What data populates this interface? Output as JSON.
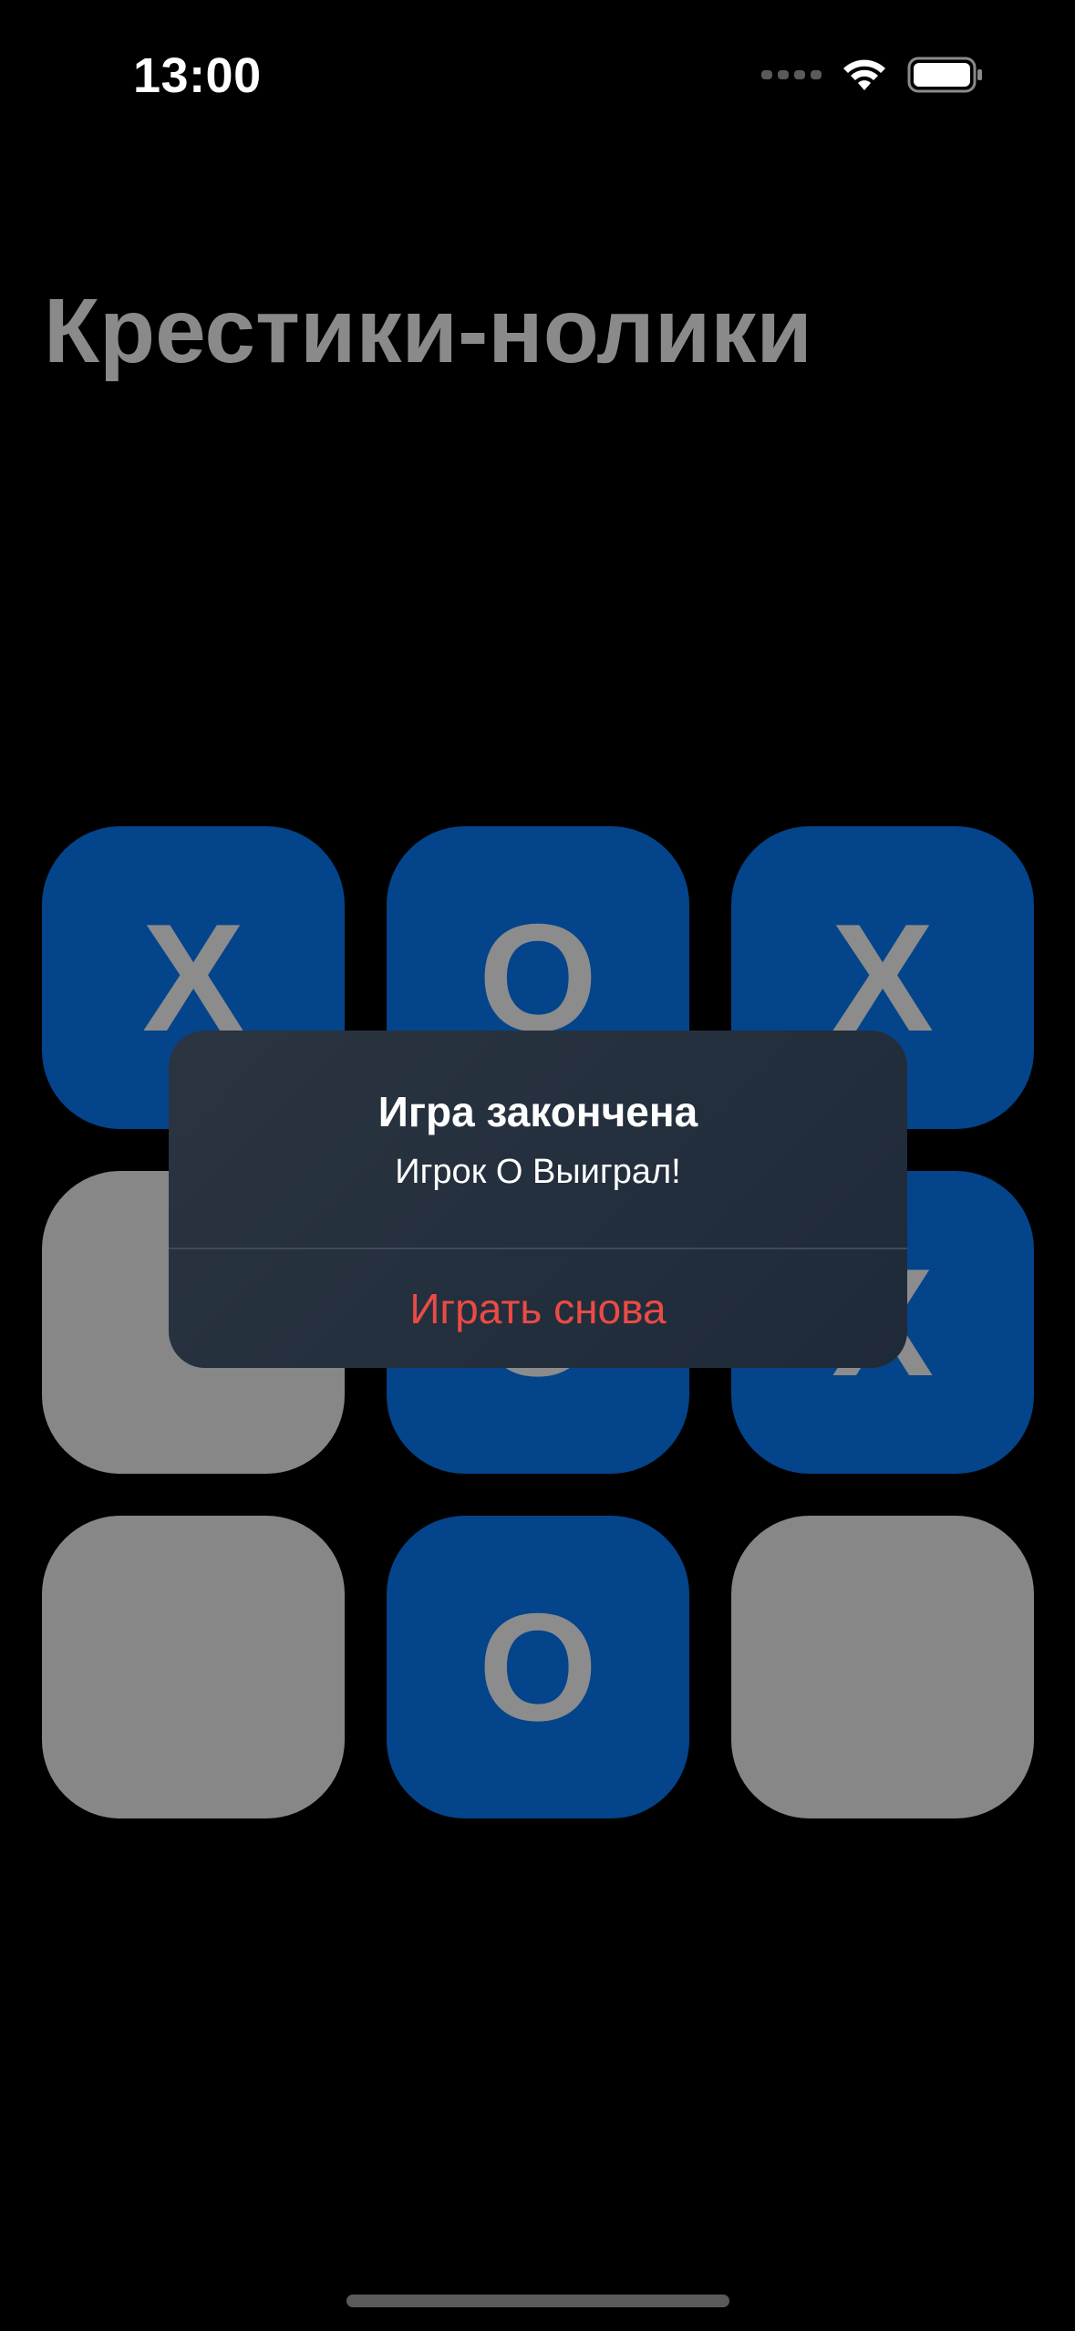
{
  "status_bar": {
    "time": "13:00",
    "icons": [
      "cellular-dots-icon",
      "wifi-icon",
      "battery-icon"
    ]
  },
  "title": "Крестики-нолики",
  "board": {
    "cells": [
      "X",
      "O",
      "X",
      "",
      "O",
      "X",
      "",
      "O",
      ""
    ]
  },
  "alert": {
    "title": "Игра закончена",
    "message": "Игрок O Выиграл!",
    "button_label": "Играть снова"
  },
  "colors": {
    "tile_filled": "#04448a",
    "tile_empty": "#878787",
    "alert_button": "#eb4b45"
  }
}
